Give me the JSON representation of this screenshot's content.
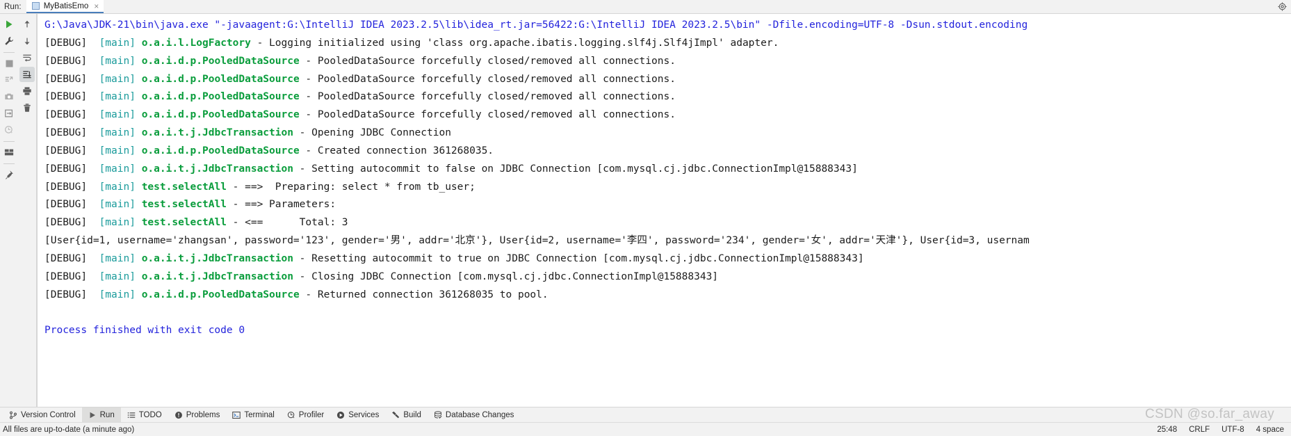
{
  "window": {
    "run_label": "Run:",
    "tab_name": "MyBatisEmo",
    "tab_close": "×",
    "settings_icon": "gear-icon"
  },
  "left_toolbar_primary": [
    {
      "name": "rerun-icon",
      "title": "Rerun"
    },
    {
      "name": "wrench-icon",
      "title": "Modify Run Configuration"
    },
    {
      "name": "stop-icon",
      "title": "Stop"
    },
    {
      "name": "thread-dump-icon",
      "title": "Dump Threads"
    },
    {
      "name": "camera-icon",
      "title": "Capture Memory Snapshot"
    },
    {
      "name": "restore-layout-icon",
      "title": "Restore Layout"
    },
    {
      "name": "profiler-clock-icon",
      "title": "Profiler"
    },
    {
      "name": "layout-icon",
      "title": "Layout Settings"
    },
    {
      "name": "pin-icon",
      "title": "Pin Tab"
    }
  ],
  "left_toolbar_secondary": [
    {
      "name": "scroll-up-icon",
      "title": "Up the Stack Trace"
    },
    {
      "name": "scroll-down-icon",
      "title": "Down the Stack Trace"
    },
    {
      "name": "soft-wrap-icon",
      "title": "Soft-Wrap"
    },
    {
      "name": "scroll-to-end-icon",
      "title": "Scroll to End",
      "selected": true
    },
    {
      "name": "print-icon",
      "title": "Print"
    },
    {
      "name": "trash-icon",
      "title": "Clear All"
    }
  ],
  "console": {
    "lines": [
      {
        "segments": [
          {
            "cls": "c-cmd",
            "text": "G:\\Java\\JDK-21\\bin\\java.exe \"-javaagent:G:\\IntelliJ IDEA 2023.2.5\\lib\\idea_rt.jar=56422:G:\\IntelliJ IDEA 2023.2.5\\bin\" -Dfile.encoding=UTF-8 -Dsun.stdout.encoding"
          }
        ]
      },
      {
        "segments": [
          {
            "cls": "c-plain",
            "text": "[DEBUG]  "
          },
          {
            "cls": "c-thread",
            "text": "[main]"
          },
          {
            "cls": "c-plain",
            "text": " "
          },
          {
            "cls": "c-logger",
            "text": "o.a.i.l.LogFactory"
          },
          {
            "cls": "c-plain",
            "text": " - Logging initialized using 'class org.apache.ibatis.logging.slf4j.Slf4jImpl' adapter."
          }
        ]
      },
      {
        "segments": [
          {
            "cls": "c-plain",
            "text": "[DEBUG]  "
          },
          {
            "cls": "c-thread",
            "text": "[main]"
          },
          {
            "cls": "c-plain",
            "text": " "
          },
          {
            "cls": "c-logger",
            "text": "o.a.i.d.p.PooledDataSource"
          },
          {
            "cls": "c-plain",
            "text": " - PooledDataSource forcefully closed/removed all connections."
          }
        ]
      },
      {
        "segments": [
          {
            "cls": "c-plain",
            "text": "[DEBUG]  "
          },
          {
            "cls": "c-thread",
            "text": "[main]"
          },
          {
            "cls": "c-plain",
            "text": " "
          },
          {
            "cls": "c-logger",
            "text": "o.a.i.d.p.PooledDataSource"
          },
          {
            "cls": "c-plain",
            "text": " - PooledDataSource forcefully closed/removed all connections."
          }
        ]
      },
      {
        "segments": [
          {
            "cls": "c-plain",
            "text": "[DEBUG]  "
          },
          {
            "cls": "c-thread",
            "text": "[main]"
          },
          {
            "cls": "c-plain",
            "text": " "
          },
          {
            "cls": "c-logger",
            "text": "o.a.i.d.p.PooledDataSource"
          },
          {
            "cls": "c-plain",
            "text": " - PooledDataSource forcefully closed/removed all connections."
          }
        ]
      },
      {
        "segments": [
          {
            "cls": "c-plain",
            "text": "[DEBUG]  "
          },
          {
            "cls": "c-thread",
            "text": "[main]"
          },
          {
            "cls": "c-plain",
            "text": " "
          },
          {
            "cls": "c-logger",
            "text": "o.a.i.d.p.PooledDataSource"
          },
          {
            "cls": "c-plain",
            "text": " - PooledDataSource forcefully closed/removed all connections."
          }
        ]
      },
      {
        "segments": [
          {
            "cls": "c-plain",
            "text": "[DEBUG]  "
          },
          {
            "cls": "c-thread",
            "text": "[main]"
          },
          {
            "cls": "c-plain",
            "text": " "
          },
          {
            "cls": "c-logger",
            "text": "o.a.i.t.j.JdbcTransaction"
          },
          {
            "cls": "c-plain",
            "text": " - Opening JDBC Connection"
          }
        ]
      },
      {
        "segments": [
          {
            "cls": "c-plain",
            "text": "[DEBUG]  "
          },
          {
            "cls": "c-thread",
            "text": "[main]"
          },
          {
            "cls": "c-plain",
            "text": " "
          },
          {
            "cls": "c-logger",
            "text": "o.a.i.d.p.PooledDataSource"
          },
          {
            "cls": "c-plain",
            "text": " - Created connection 361268035."
          }
        ]
      },
      {
        "segments": [
          {
            "cls": "c-plain",
            "text": "[DEBUG]  "
          },
          {
            "cls": "c-thread",
            "text": "[main]"
          },
          {
            "cls": "c-plain",
            "text": " "
          },
          {
            "cls": "c-logger",
            "text": "o.a.i.t.j.JdbcTransaction"
          },
          {
            "cls": "c-plain",
            "text": " - Setting autocommit to false on JDBC Connection [com.mysql.cj.jdbc.ConnectionImpl@15888343]"
          }
        ]
      },
      {
        "segments": [
          {
            "cls": "c-plain",
            "text": "[DEBUG]  "
          },
          {
            "cls": "c-thread",
            "text": "[main]"
          },
          {
            "cls": "c-plain",
            "text": " "
          },
          {
            "cls": "c-logger",
            "text": "test.selectAll"
          },
          {
            "cls": "c-plain",
            "text": " - ==>  Preparing: select * from tb_user;"
          }
        ]
      },
      {
        "segments": [
          {
            "cls": "c-plain",
            "text": "[DEBUG]  "
          },
          {
            "cls": "c-thread",
            "text": "[main]"
          },
          {
            "cls": "c-plain",
            "text": " "
          },
          {
            "cls": "c-logger",
            "text": "test.selectAll"
          },
          {
            "cls": "c-plain",
            "text": " - ==> Parameters:"
          }
        ]
      },
      {
        "segments": [
          {
            "cls": "c-plain",
            "text": "[DEBUG]  "
          },
          {
            "cls": "c-thread",
            "text": "[main]"
          },
          {
            "cls": "c-plain",
            "text": " "
          },
          {
            "cls": "c-logger",
            "text": "test.selectAll"
          },
          {
            "cls": "c-plain",
            "text": " - <==      Total: 3"
          }
        ]
      },
      {
        "segments": [
          {
            "cls": "c-data",
            "text": "[User{id=1, username='zhangsan', password='123', gender='男', addr='北京'}, User{id=2, username='李四', password='234', gender='女', addr='天津'}, User{id=3, usernam"
          }
        ]
      },
      {
        "segments": [
          {
            "cls": "c-plain",
            "text": "[DEBUG]  "
          },
          {
            "cls": "c-thread",
            "text": "[main]"
          },
          {
            "cls": "c-plain",
            "text": " "
          },
          {
            "cls": "c-logger",
            "text": "o.a.i.t.j.JdbcTransaction"
          },
          {
            "cls": "c-plain",
            "text": " - Resetting autocommit to true on JDBC Connection [com.mysql.cj.jdbc.ConnectionImpl@15888343]"
          }
        ]
      },
      {
        "segments": [
          {
            "cls": "c-plain",
            "text": "[DEBUG]  "
          },
          {
            "cls": "c-thread",
            "text": "[main]"
          },
          {
            "cls": "c-plain",
            "text": " "
          },
          {
            "cls": "c-logger",
            "text": "o.a.i.t.j.JdbcTransaction"
          },
          {
            "cls": "c-plain",
            "text": " - Closing JDBC Connection [com.mysql.cj.jdbc.ConnectionImpl@15888343]"
          }
        ]
      },
      {
        "segments": [
          {
            "cls": "c-plain",
            "text": "[DEBUG]  "
          },
          {
            "cls": "c-thread",
            "text": "[main]"
          },
          {
            "cls": "c-plain",
            "text": " "
          },
          {
            "cls": "c-logger",
            "text": "o.a.i.d.p.PooledDataSource"
          },
          {
            "cls": "c-plain",
            "text": " - Returned connection 361268035 to pool."
          }
        ]
      },
      {
        "segments": [
          {
            "cls": "c-plain",
            "text": ""
          }
        ]
      },
      {
        "segments": [
          {
            "cls": "c-finish",
            "text": "Process finished with exit code 0"
          }
        ]
      }
    ]
  },
  "tool_window_bar": [
    {
      "label": "Version Control",
      "icon": "branch-icon",
      "active": false
    },
    {
      "label": "Run",
      "icon": "play-icon",
      "active": true
    },
    {
      "label": "TODO",
      "icon": "list-icon",
      "active": false
    },
    {
      "label": "Problems",
      "icon": "exclamation-circle-icon",
      "active": false
    },
    {
      "label": "Terminal",
      "icon": "terminal-icon",
      "active": false
    },
    {
      "label": "Profiler",
      "icon": "profiler-icon",
      "active": false
    },
    {
      "label": "Services",
      "icon": "services-icon",
      "active": false
    },
    {
      "label": "Build",
      "icon": "hammer-icon",
      "active": false
    },
    {
      "label": "Database Changes",
      "icon": "database-icon",
      "active": false
    }
  ],
  "status_bar": {
    "message": "All files are up-to-date (a minute ago)",
    "caret_position": "25:48",
    "line_separator": "CRLF",
    "encoding": "UTF-8",
    "indent": "4 space"
  },
  "watermark": "CSDN @so.far_away",
  "colors": {
    "accent": "#4a7ebb",
    "logger_green": "#0a9d3c",
    "thread_teal": "#1a9b9b",
    "command_blue": "#2323dc",
    "chrome_bg": "#f2f2f2",
    "console_bg": "#ffffff"
  }
}
